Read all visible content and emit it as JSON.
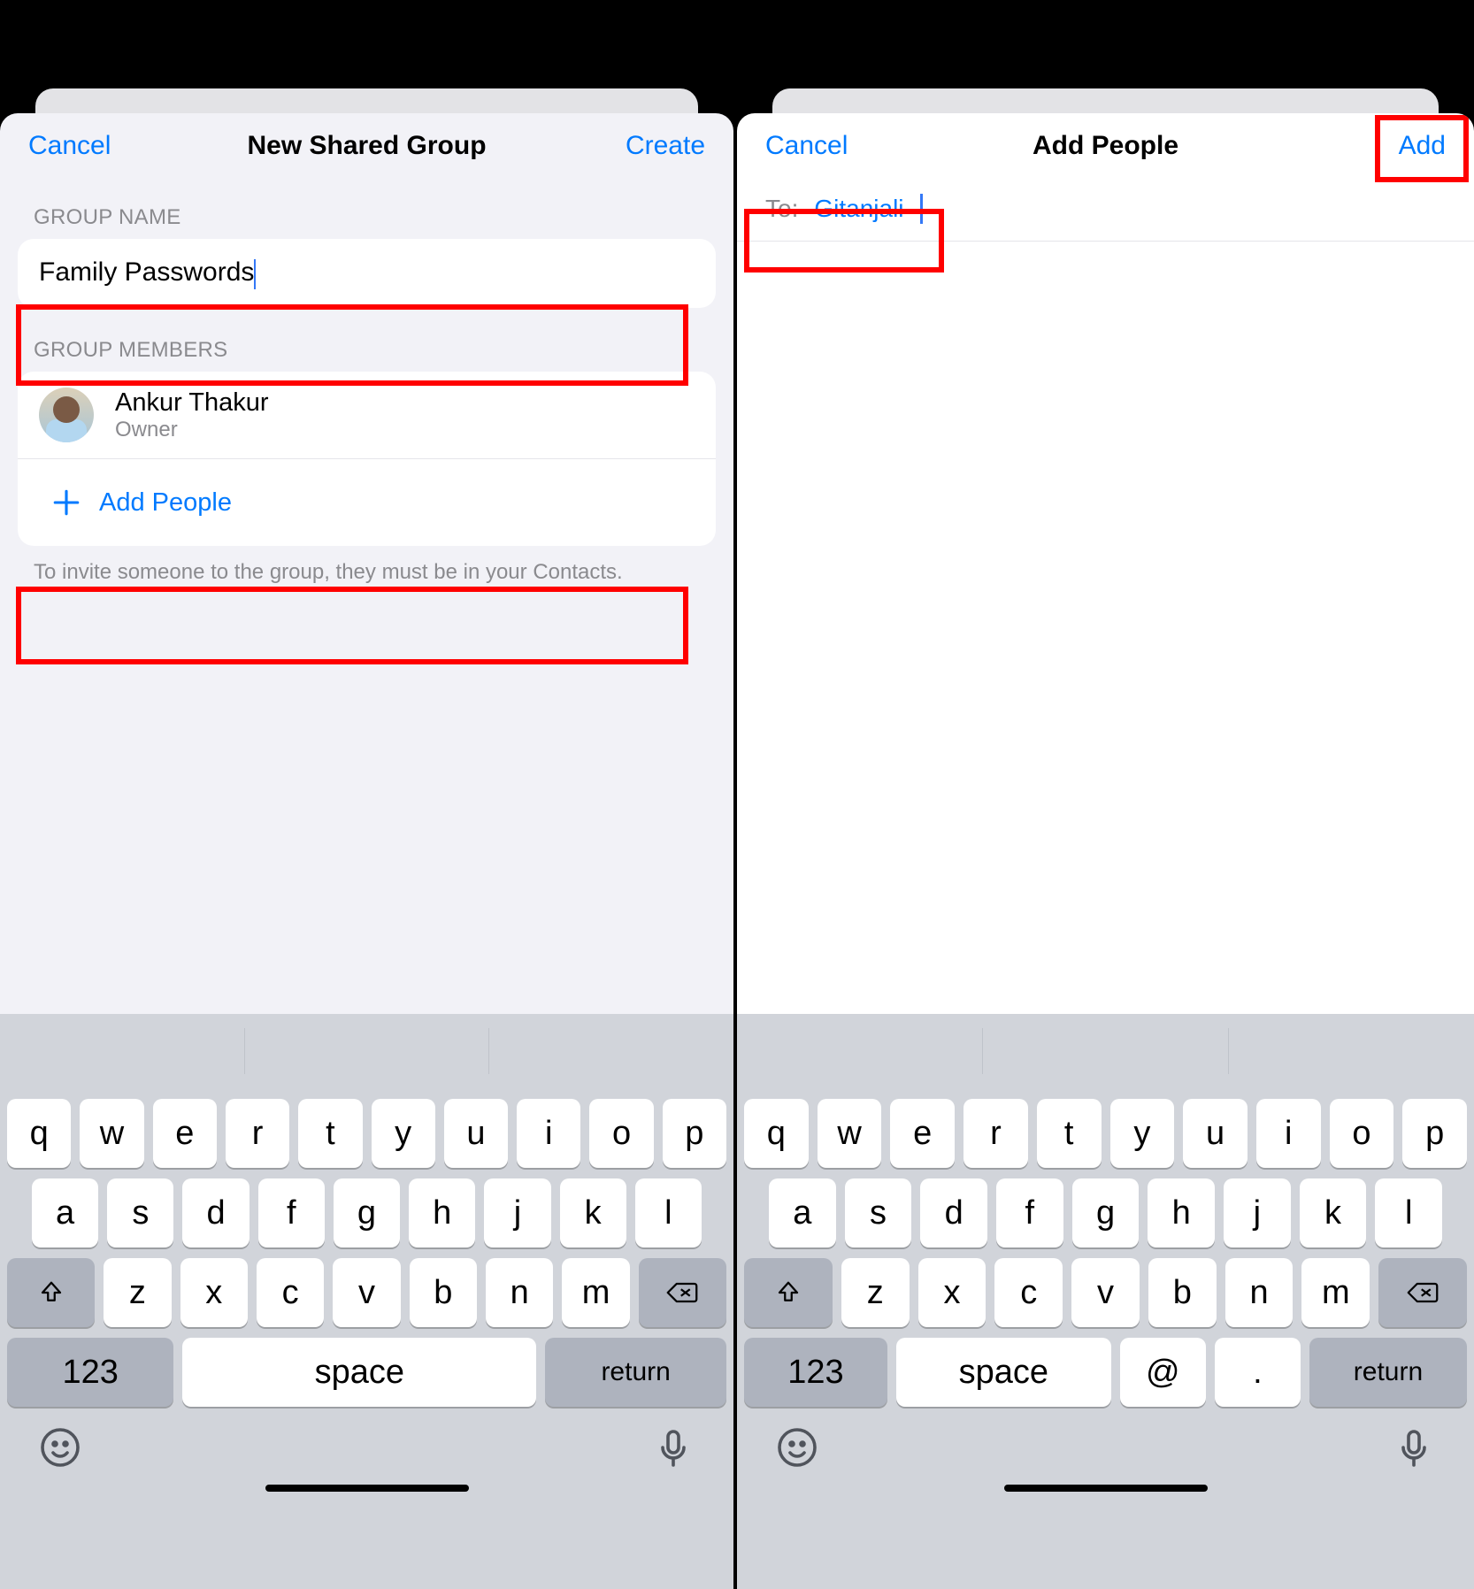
{
  "left": {
    "nav": {
      "cancel": "Cancel",
      "title": "New Shared Group",
      "action": "Create"
    },
    "sections": {
      "groupNameLabel": "GROUP NAME",
      "groupNameValue": "Family Passwords",
      "groupMembersLabel": "GROUP MEMBERS"
    },
    "member": {
      "name": "Ankur Thakur",
      "role": "Owner"
    },
    "addPeople": "Add People",
    "footnote": "To invite someone to the group, they must be in your Contacts."
  },
  "right": {
    "nav": {
      "cancel": "Cancel",
      "title": "Add People",
      "action": "Add"
    },
    "toLabel": "To:",
    "recipient": "Gitanjali"
  },
  "keyboard": {
    "row1": [
      "q",
      "w",
      "e",
      "r",
      "t",
      "y",
      "u",
      "i",
      "o",
      "p"
    ],
    "row2": [
      "a",
      "s",
      "d",
      "f",
      "g",
      "h",
      "j",
      "k",
      "l"
    ],
    "row3": [
      "z",
      "x",
      "c",
      "v",
      "b",
      "n",
      "m"
    ],
    "numbers": "123",
    "space": "space",
    "ret": "return",
    "at": "@",
    "dot": "."
  }
}
